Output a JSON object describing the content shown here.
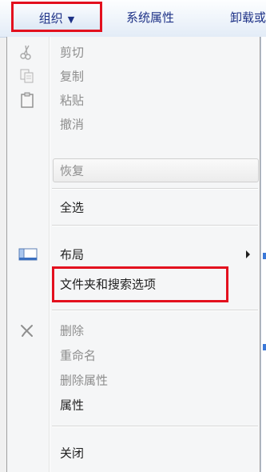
{
  "toolbar": {
    "organize_label": "组织",
    "organize_caret": "▼",
    "system_properties_label": "系统属性",
    "uninstall_label": "卸载或"
  },
  "menu": {
    "items": [
      {
        "label": "剪切",
        "icon": "cut-icon",
        "enabled": false
      },
      {
        "label": "复制",
        "icon": "copy-icon",
        "enabled": false
      },
      {
        "label": "粘贴",
        "icon": "paste-icon",
        "enabled": false
      },
      {
        "label": "撤消",
        "icon": "",
        "enabled": false
      },
      {
        "label": "恢复",
        "icon": "",
        "enabled": false
      },
      {
        "label": "全选",
        "icon": "",
        "enabled": true
      },
      {
        "label": "布局",
        "icon": "layout-icon",
        "enabled": true,
        "submenu": true
      },
      {
        "label": "文件夹和搜索选项",
        "icon": "",
        "enabled": true
      },
      {
        "label": "删除",
        "icon": "delete-icon",
        "enabled": false
      },
      {
        "label": "重命名",
        "icon": "",
        "enabled": false
      },
      {
        "label": "删除属性",
        "icon": "",
        "enabled": false
      },
      {
        "label": "属性",
        "icon": "",
        "enabled": true
      },
      {
        "label": "关闭",
        "icon": "",
        "enabled": true
      }
    ]
  },
  "colors": {
    "highlight_box": "#e3101e",
    "toolbar_text": "#1e3287",
    "disabled_text": "#8d8d8d"
  }
}
